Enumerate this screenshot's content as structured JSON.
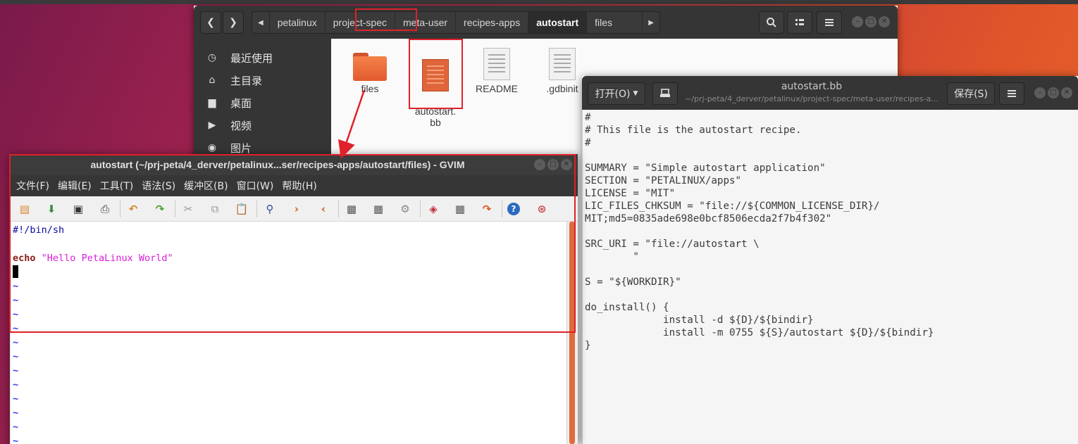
{
  "nautilus": {
    "breadcrumbs": [
      "petalinux",
      "project-spec",
      "meta-user",
      "recipes-apps",
      "autostart",
      "files"
    ],
    "sidebar": [
      {
        "label": "最近使用",
        "icon": "clock-icon"
      },
      {
        "label": "主目录",
        "icon": "home-icon"
      },
      {
        "label": "桌面",
        "icon": "folder-icon"
      },
      {
        "label": "视频",
        "icon": "video-icon"
      },
      {
        "label": "图片",
        "icon": "camera-icon"
      }
    ],
    "files": [
      {
        "name": "files",
        "type": "folder"
      },
      {
        "name": "autostart.\nbb",
        "type": "document-orange"
      },
      {
        "name": "README",
        "type": "document"
      },
      {
        "name": ".gdbinit",
        "type": "document"
      }
    ]
  },
  "gedit": {
    "open_label": "打开(O)",
    "save_label": "保存(S)",
    "title": "autostart.bb",
    "subtitle": "~/prj-peta/4_derver/petalinux/project-spec/meta-user/recipes-a...",
    "content": "#\n# This file is the autostart recipe.\n#\n\nSUMMARY = \"Simple autostart application\"\nSECTION = \"PETALINUX/apps\"\nLICENSE = \"MIT\"\nLIC_FILES_CHKSUM = \"file://${COMMON_LICENSE_DIR}/\nMIT;md5=0835ade698e0bcf8506ecda2f7b4f302\"\n\nSRC_URI = \"file://autostart \\\n        \"\n\nS = \"${WORKDIR}\"\n\ndo_install() {\n             install -d ${D}/${bindir}\n             install -m 0755 ${S}/autostart ${D}/${bindir}\n}"
  },
  "gvim": {
    "title": "autostart (~/prj-peta/4_derver/petalinux...ser/recipes-apps/autostart/files) - GVIM",
    "menu": [
      "文件(F)",
      "编辑(E)",
      "工具(T)",
      "语法(S)",
      "缓冲区(B)",
      "窗口(W)",
      "帮助(H)"
    ],
    "lines": {
      "shebang": "#!/bin/sh",
      "echo_kw": "echo",
      "echo_str_open": "\"",
      "echo_str_body": "Hello PetaLinux World",
      "echo_str_close": "\""
    },
    "tilde": "~"
  },
  "colors": {
    "highlight_red": "#e0202a",
    "vim_tilde": "#2a3df0",
    "vim_string": "#d81ed8",
    "vim_keyword": "#8b1a1a",
    "vim_comment": "#0a0aa0"
  }
}
